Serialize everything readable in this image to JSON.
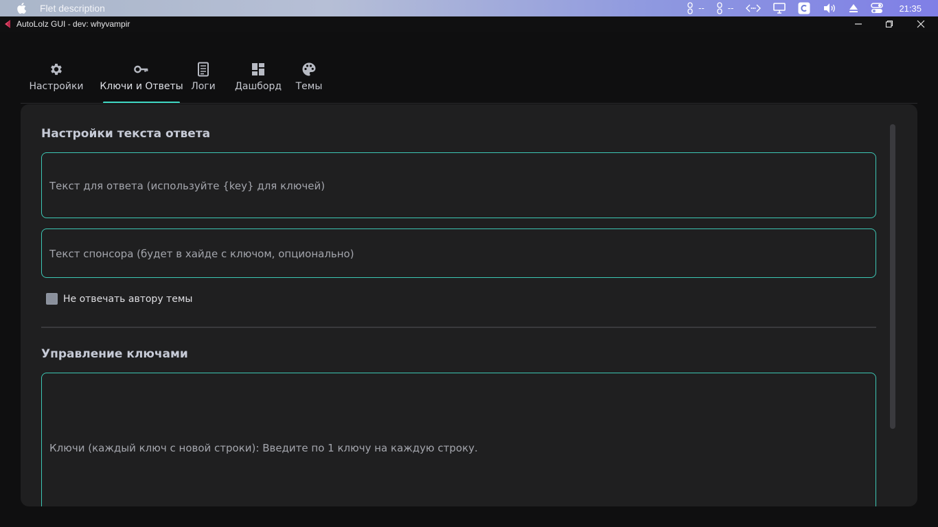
{
  "menubar": {
    "app_name": "Flet description",
    "tray_dash_1": "--",
    "tray_dash_2": "--",
    "clock": "21:35"
  },
  "window": {
    "title": "AutoLolz GUI - dev: whyvampir"
  },
  "tabs": [
    {
      "label": "Настройки",
      "icon": "gear-icon",
      "active": false
    },
    {
      "label": "Ключи и Ответы",
      "icon": "key-icon",
      "active": true
    },
    {
      "label": "Логи",
      "icon": "log-icon",
      "active": false
    },
    {
      "label": "Дашборд",
      "icon": "dashboard-icon",
      "active": false
    },
    {
      "label": "Темы",
      "icon": "palette-icon",
      "active": false
    }
  ],
  "reply_settings": {
    "title": "Настройки текста ответа",
    "reply_text_placeholder": "Текст для ответа (используйте {key} для ключей)",
    "sponsor_text_placeholder": "Текст спонсора (будет в хайде с ключом, опционально)",
    "no_reply_to_author_label": "Не отвечать автору темы",
    "no_reply_to_author_checked": false
  },
  "keys_management": {
    "title": "Управление ключами",
    "keys_placeholder": "Ключи (каждый ключ с новой строки): Введите по 1 ключу на каждую строку."
  },
  "colors": {
    "accent": "#3ed8c3",
    "background": "#0f0f10",
    "panel": "#1f1f20"
  }
}
